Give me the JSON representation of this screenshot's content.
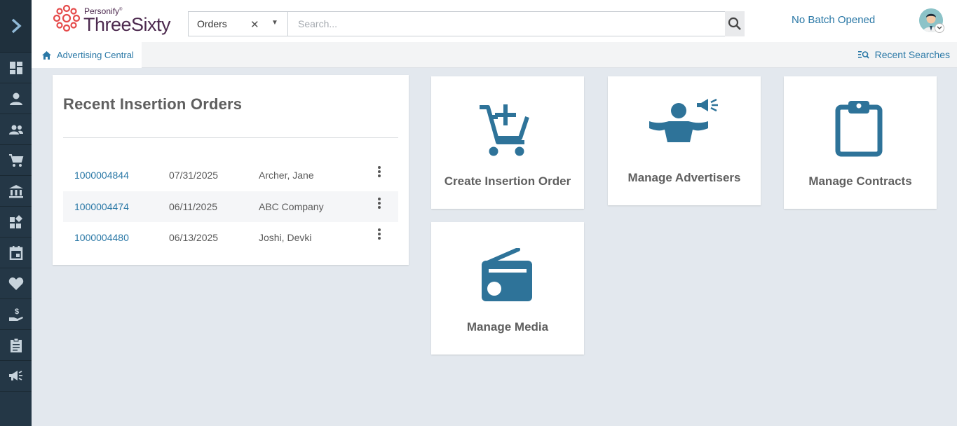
{
  "brand": {
    "company": "Personify",
    "trademark": "®",
    "product": "ThreeSixty",
    "accent_color": "#2a78a6",
    "logo_color": "#e54b4b"
  },
  "search": {
    "scope": "Orders",
    "placeholder": "Search..."
  },
  "header": {
    "batch_status": "No Batch Opened"
  },
  "sidebar": {
    "items": [
      {
        "icon": "dashboard-icon"
      },
      {
        "icon": "person-icon"
      },
      {
        "icon": "group-icon"
      },
      {
        "icon": "cart-icon"
      },
      {
        "icon": "bank-icon"
      },
      {
        "icon": "widgets-icon"
      },
      {
        "icon": "calendar-icon"
      },
      {
        "icon": "heart-icon"
      },
      {
        "icon": "donation-icon"
      },
      {
        "icon": "clipboard-icon"
      },
      {
        "icon": "megaphone-icon"
      }
    ]
  },
  "subbar": {
    "home_tab": "Advertising Central",
    "recent_searches": "Recent Searches"
  },
  "recent_orders": {
    "title": "Recent Insertion Orders",
    "rows": [
      {
        "number": "1000004844",
        "date": "07/31/2025",
        "name": "Archer, Jane"
      },
      {
        "number": "1000004474",
        "date": "06/11/2025",
        "name": "ABC Company"
      },
      {
        "number": "1000004480",
        "date": "06/13/2025",
        "name": "Joshi, Devki"
      }
    ]
  },
  "tiles": {
    "create_order": "Create Insertion Order",
    "manage_advertisers": "Manage Advertisers",
    "manage_contracts": "Manage Contracts",
    "manage_media": "Manage Media"
  }
}
